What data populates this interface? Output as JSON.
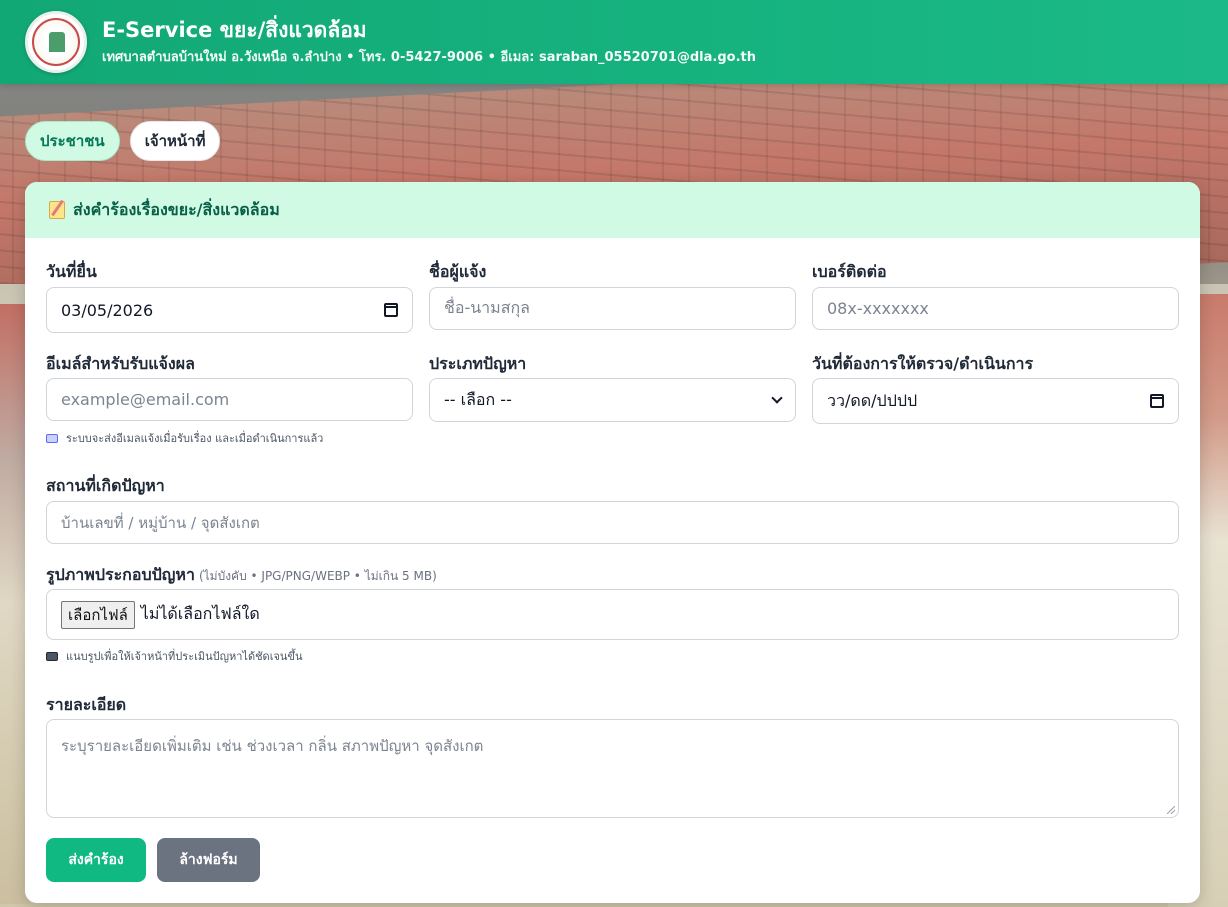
{
  "header": {
    "title": "E-Service ขยะ/สิ่งแวดล้อม",
    "subtitle": "เทศบาลตำบลบ้านใหม่ อ.วังเหนือ จ.ลำปาง • โทร. 0-5427-9006 • อีเมล: saraban_05520701@dla.go.th",
    "logo_icon": "municipal-seal-icon"
  },
  "tabs": [
    {
      "label": "ประชาชน",
      "active": true
    },
    {
      "label": "เจ้าหน้าที่",
      "active": false
    }
  ],
  "form": {
    "title": "ส่งคำร้องเรื่องขยะ/สิ่งแวดล้อม",
    "title_icon": "memo-icon",
    "date_filed": {
      "label": "วันที่ยื่น",
      "value": "03/05/2026"
    },
    "reporter_name": {
      "label": "ชื่อผู้แจ้ง",
      "placeholder": "ชื่อ-นามสกุล"
    },
    "phone": {
      "label": "เบอร์ติดต่อ",
      "placeholder": "08x-xxxxxxx"
    },
    "email": {
      "label": "อีเมล์สำหรับรับแจ้งผล",
      "placeholder": "example@email.com",
      "hint": "ระบบจะส่งอีเมลแจ้งเมื่อรับเรื่อง และเมื่อดำเนินการแล้ว"
    },
    "problem_type": {
      "label": "ประเภทปัญหา",
      "selected": "-- เลือก --"
    },
    "inspect_date": {
      "label": "วันที่ต้องการให้ตรวจ/ดำเนินการ",
      "value": "วว/ดด/ปปปป"
    },
    "location": {
      "label": "สถานที่เกิดปัญหา",
      "placeholder": "บ้านเลขที่ / หมู่บ้าน / จุดสังเกต"
    },
    "photo": {
      "label": "รูปภาพประกอบปัญหา",
      "note": "(ไม่บังคับ • JPG/PNG/WEBP • ไม่เกิน 5 MB)",
      "button": "เลือกไฟล์",
      "status": "ไม่ได้เลือกไฟล์ใด",
      "hint": "แนบรูปเพื่อให้เจ้าหน้าที่ประเมินปัญหาได้ชัดเจนขึ้น"
    },
    "details": {
      "label": "รายละเอียด",
      "placeholder": "ระบุรายละเอียดเพิ่มเติม เช่น ช่วงเวลา กลิ่น สภาพปัญหา จุดสังเกต"
    },
    "submit_label": "ส่งคำร้อง",
    "reset_label": "ล้างฟอร์ม"
  },
  "colors": {
    "brand": "#12a876",
    "accent_light": "#d1fae5",
    "primary_button": "#10b981",
    "secondary_button": "#6b7280"
  }
}
